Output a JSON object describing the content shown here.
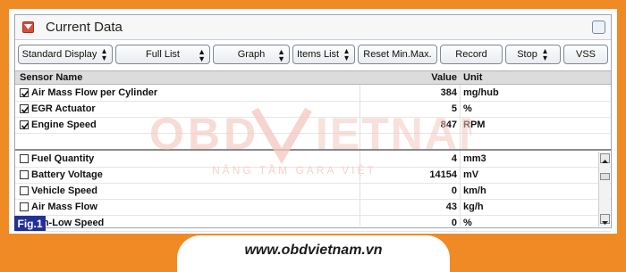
{
  "window": {
    "title": "Current Data"
  },
  "toolbar": {
    "display_mode": "Standard Display",
    "list_mode": "Full List",
    "view_mode": "Graph",
    "items_list": "Items List",
    "reset": "Reset Min.Max.",
    "record": "Record",
    "stop": "Stop",
    "vss": "VSS"
  },
  "table": {
    "headers": {
      "name": "Sensor Name",
      "value": "Value",
      "unit": "Unit"
    },
    "rows": [
      {
        "name": "Air Mass Flow per Cylinder",
        "value": "384",
        "unit": "mg/hub",
        "checked": true
      },
      {
        "name": "EGR Actuator",
        "value": "5",
        "unit": "%",
        "checked": true
      },
      {
        "name": "Engine Speed",
        "value": "847",
        "unit": "RPM",
        "checked": true
      },
      {
        "name": "Fuel Quantity",
        "value": "4",
        "unit": "mm3",
        "checked": false
      },
      {
        "name": "Battery Voltage",
        "value": "14154",
        "unit": "mV",
        "checked": false
      },
      {
        "name": "Vehicle Speed",
        "value": "0",
        "unit": "km/h",
        "checked": false
      },
      {
        "name": "Air Mass Flow",
        "value": "43",
        "unit": "kg/h",
        "checked": false
      },
      {
        "name": "Fan-Low Speed",
        "value": "0",
        "unit": "%",
        "checked": false
      }
    ]
  },
  "watermark": {
    "brand": "OBDVIETNAM",
    "tagline": "NÂNG TẦM GARA VIỆT"
  },
  "figure_label": "Fig.1",
  "footer": {
    "website": "www.obdvietnam.vn"
  },
  "colors": {
    "background": "#f08a24",
    "fig_badge": "#23309a",
    "watermark": "#f3c7be"
  }
}
